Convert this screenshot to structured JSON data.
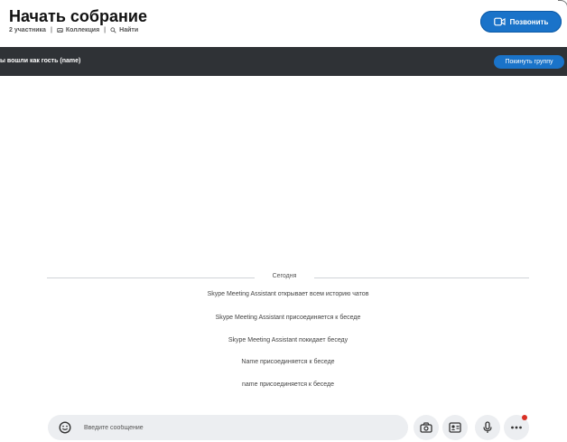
{
  "header": {
    "title": "Начать собрание",
    "participants": "2 участника",
    "collection_label": "Коллекция",
    "search_label": "Найти",
    "call_button": "Позвонить"
  },
  "banner": {
    "guest_text": "ы вошли как гость (name)",
    "leave_button": "Покинуть группу"
  },
  "chat": {
    "date_separator": "Сегодня",
    "messages": [
      "Skype Meeting Assistant открывает всем историю чатов",
      "Skype Meeting Assistant присоединяется к беседе",
      "Skype Meeting Assistant покидает беседу",
      "Name присоединяется к беседе",
      "name присоединяется к беседе"
    ]
  },
  "compose": {
    "placeholder": "Введите сообщение"
  },
  "colors": {
    "accent": "#1a73c9",
    "banner": "#2f3236",
    "notification": "#d93025"
  },
  "icons": {
    "collection": "gallery-icon",
    "search": "search-icon",
    "call": "video-camera-icon",
    "emoji": "emoji-icon",
    "media": "media-gallery-icon",
    "contact": "contact-card-icon",
    "mic": "microphone-icon",
    "more": "more-options-icon"
  }
}
